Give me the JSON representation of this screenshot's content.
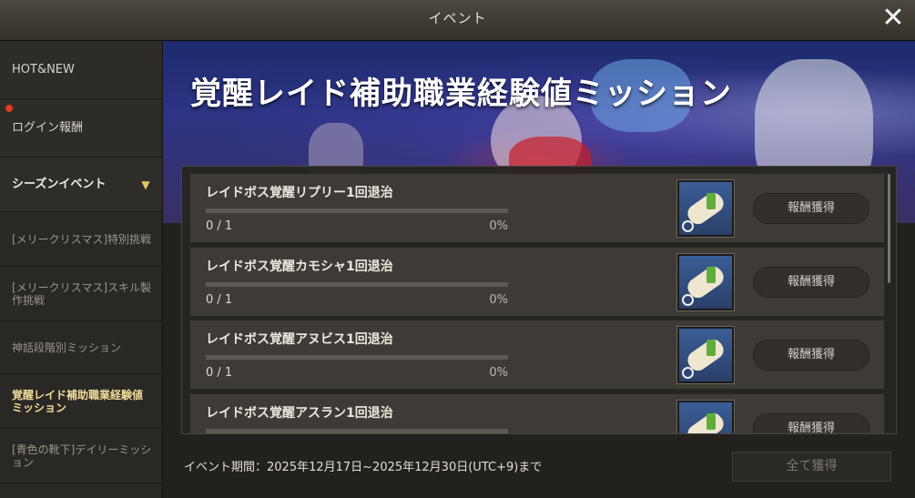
{
  "window": {
    "title": "イベント",
    "close_icon": "close-icon"
  },
  "sidebar": {
    "items": [
      {
        "label": "HOT&NEW"
      },
      {
        "label": "ログイン報酬",
        "badge": "new-dot"
      },
      {
        "label": "シーズンイベント",
        "icon": "chevron-down-icon"
      },
      {
        "label": "[メリークリスマス]特別挑戦"
      },
      {
        "label": "[メリークリスマス]スキル製作挑戦"
      },
      {
        "label": "神話段階別ミッション"
      },
      {
        "label": "覚醒レイド補助職業経験値ミッション",
        "active": true
      },
      {
        "label": "[青色の靴下]デイリーミッション"
      }
    ]
  },
  "banner": {
    "title": "覚醒レイド補助職業経験値ミッション"
  },
  "missions": [
    {
      "title": "レイドボス覚醒リプリー1回退治",
      "progress": "0 / 1",
      "percent": "0%",
      "reward_icon": "scroll-icon",
      "button": "報酬獲得"
    },
    {
      "title": "レイドボス覚醒カモシャ1回退治",
      "progress": "0 / 1",
      "percent": "0%",
      "reward_icon": "scroll-icon",
      "button": "報酬獲得"
    },
    {
      "title": "レイドボス覚醒アヌビス1回退治",
      "progress": "0 / 1",
      "percent": "0%",
      "reward_icon": "scroll-icon",
      "button": "報酬獲得"
    },
    {
      "title": "レイドボス覚醒アスラン1回退治",
      "progress": "",
      "percent": "",
      "reward_icon": "scroll-icon",
      "button": "報酬獲得"
    }
  ],
  "footer": {
    "period": "イベント期間：2025年12月17日~2025年12月30日(UTC+9)まで",
    "claim_all": "全て獲得"
  }
}
